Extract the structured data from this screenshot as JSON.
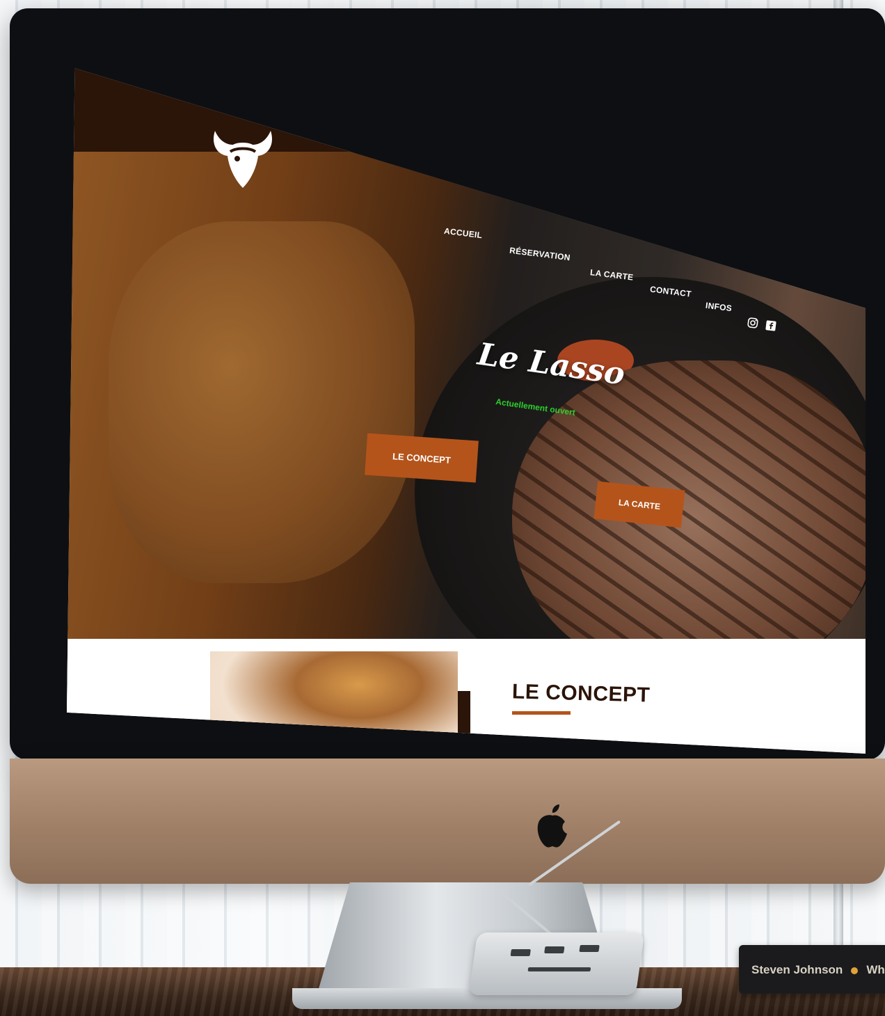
{
  "site": {
    "nav": [
      {
        "label": "ACCUEIL"
      },
      {
        "label": "RÉSERVATION"
      },
      {
        "label": "LA CARTE"
      },
      {
        "label": "CONTACT"
      },
      {
        "label": "INFOS"
      }
    ],
    "social_icons": [
      "instagram-icon",
      "facebook-icon"
    ],
    "hero": {
      "title": "Le Lasso",
      "status": "Actuellement ouvert",
      "buttons": {
        "concept": "LE CONCEPT",
        "carte": "LA CARTE"
      }
    },
    "concept": {
      "heading": "LE CONCEPT"
    },
    "colors": {
      "header_bg": "#2b1408",
      "accent": "#b4541b",
      "status": "#2ccf2c"
    }
  },
  "book": {
    "spine_author": "Steven Johnson",
    "spine_title": "Where"
  }
}
